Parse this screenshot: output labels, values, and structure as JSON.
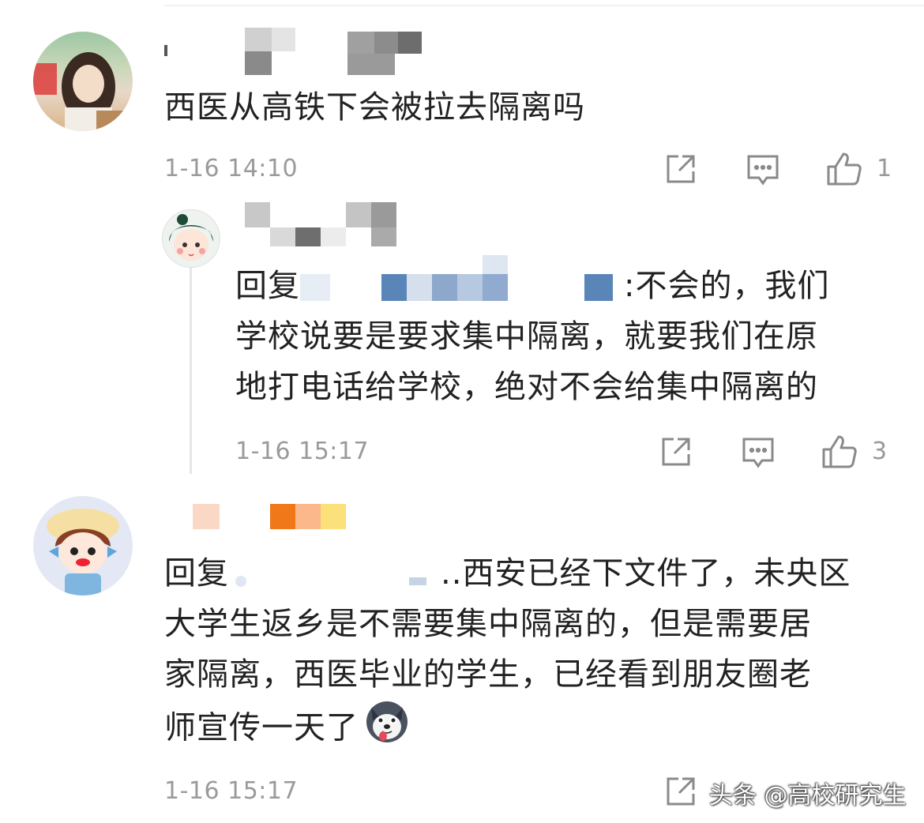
{
  "comments": [
    {
      "text": "西医从高铁下会被拉去隔离吗",
      "time": "1-16 14:10",
      "likes": "1"
    },
    {
      "reply_prefix": "回复",
      "text_line1": ":不会的，我们",
      "text_line2": "学校说要是要求集中隔离，就要我们在原",
      "text_line3": "地打电话给学校，绝对不会给集中隔离的",
      "time": "1-16 15:17",
      "likes": "3"
    },
    {
      "reply_prefix": "回复",
      "text_line1": "..西安已经下文件了，未央区",
      "text_line2": "大学生返乡是不需要集中隔离的，但是需要居",
      "text_line3": "家隔离，西医毕业的学生，已经看到朋友圈老",
      "text_line4": "师宣传一天了",
      "time": "1-16 15:17"
    }
  ],
  "watermark": "头条 @高校研究生",
  "colors": {
    "meta_gray": "#9a9a9a",
    "mention_blue": "#5a8bc0",
    "thread_line": "#e6e6e6"
  },
  "icons": [
    "share-icon",
    "reply-icon",
    "like-icon",
    "dog-emoji-icon"
  ]
}
